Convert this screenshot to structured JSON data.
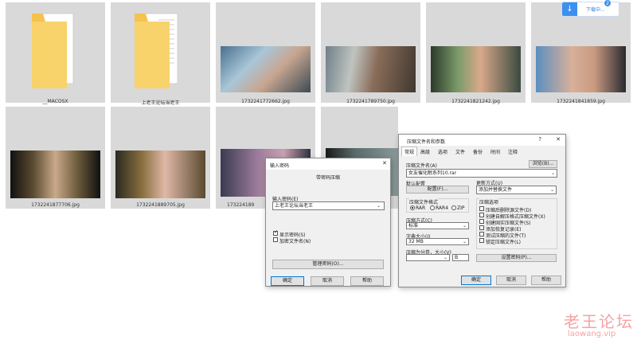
{
  "files": [
    {
      "name": "__MACOSX",
      "kind": "folder"
    },
    {
      "name": "上老王论坛当老王",
      "kind": "folder"
    },
    {
      "name": "1732241772662.jpg",
      "kind": "image"
    },
    {
      "name": "1732241789750.jpg",
      "kind": "image"
    },
    {
      "name": "1732241821242.jpg",
      "kind": "image"
    },
    {
      "name": "1732241841859.jpg",
      "kind": "image"
    },
    {
      "name": "1732241877706.jpg",
      "kind": "image"
    },
    {
      "name": "1732241889705.jpg",
      "kind": "image"
    },
    {
      "name": "173224189",
      "kind": "image"
    },
    {
      "name": "",
      "kind": "image"
    }
  ],
  "download_pill": {
    "text": "下载中...",
    "badge": "2"
  },
  "password_dialog": {
    "title": "输入密码",
    "header": "带密码压缩",
    "input_label": "输入密码(E)",
    "password_value": "上老王论坛当老王",
    "show_password": "显示密码(S)",
    "encrypt_names": "加密文件名(N)",
    "manage_button": "管理密码(O)...",
    "ok": "确定",
    "cancel": "取消",
    "help": "帮助",
    "close_glyph": "✕"
  },
  "archive_dialog": {
    "title": "压缩文件名和参数",
    "title_buttons": {
      "help": "?",
      "close": "✕"
    },
    "tabs": [
      "常规",
      "高级",
      "选项",
      "文件",
      "备份",
      "时间",
      "注释"
    ],
    "archive_name_label": "压缩文件名(A)",
    "browse_button": "浏览(B)...",
    "archive_name_value": "女友催化眠系列10.rar",
    "default_profile_label": "默认配置",
    "profile_button": "配置(F)...",
    "update_mode_label": "更新方式(U)",
    "update_mode_value": "添加并替换文件",
    "format_label": "压缩文件格式",
    "formats": [
      "RAR",
      "RAR4",
      "ZIP"
    ],
    "method_label": "压缩方式(C)",
    "method_value": "标准",
    "dict_label": "字典大小(I)",
    "dict_value": "32 MB",
    "split_label": "压缩为分卷，大小(V)",
    "split_unit": "B",
    "options_label": "压缩选项",
    "options": [
      "压缩后删除源文件(D)",
      "创建自解压格式压缩文件(X)",
      "创建固实压缩文件(S)",
      "添加恢复记录(E)",
      "测试压缩的文件(T)",
      "锁定压缩文件(L)"
    ],
    "set_password_button": "设置密码(P)...",
    "ok": "确定",
    "cancel": "取消",
    "help": "帮助"
  },
  "watermark": {
    "cn": "老王论坛",
    "en": "laowang.vip"
  },
  "colors": {
    "tile": "#d9d9d9",
    "accent": "#3b8ff0",
    "watermark": "#f4a3a3"
  }
}
